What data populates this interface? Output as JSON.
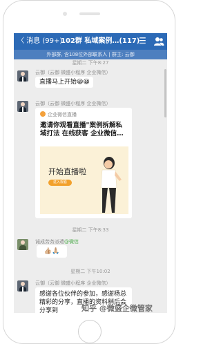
{
  "navbar": {
    "back_label": "〈 消息 (99+)",
    "title": "102群 私域案例…(117)",
    "menu_glyph": "☰"
  },
  "subbar": {
    "text": "外部群, 含108位外部联系人 | 群主: 云御"
  },
  "messages": {
    "time1": "星期二 下午8:27",
    "msg1": {
      "sender": "云御（云御 微盛小程序 企业微信）",
      "text": "直播马上开始😀😀"
    },
    "msg2": {
      "sender": "云御（云御 微盛小程序 企业微信）",
      "card_source": "企业微信直播",
      "card_title": "邀请你观看直播\"案例拆解私域打法 在线获客 企业微信…",
      "card_image_text": "开始直播啦",
      "card_image_button": "进入观看"
    },
    "time2": "星期二 下午8:33",
    "msg3": {
      "sender": "诚成劳务派遣",
      "sender_tag": "@微信",
      "text": "👍🏼🙏🏼"
    },
    "time3": "星期二 下午10:02",
    "msg4": {
      "sender": "云御（云御 微盛小程序 企业微信）",
      "text": "感谢各位伙伴的参加，感谢杨总精彩的分享，直播的资料稍后会分享到"
    }
  },
  "watermark": "知乎 @微盛企微管家",
  "colors": {
    "navbar": "#2c6ab6",
    "chat_bg": "#ededed",
    "accent_orange": "#f2a12c"
  }
}
